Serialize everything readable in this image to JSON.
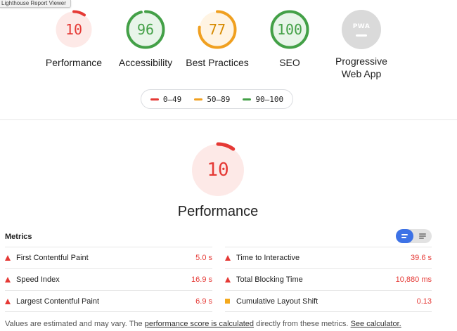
{
  "tooltip": "Lighthouse Report Viewer",
  "gauges": [
    {
      "score": "10",
      "label": "Performance",
      "fraction": 0.1,
      "color": "#e53935",
      "bg": "#fde9e7"
    },
    {
      "score": "96",
      "label": "Accessibility",
      "fraction": 0.96,
      "color": "#43a047",
      "bg": "#e8f5e9"
    },
    {
      "score": "77",
      "label": "Best Practices",
      "fraction": 0.77,
      "color": "#f0a020",
      "bg": "#fff4e3"
    },
    {
      "score": "100",
      "label": "SEO",
      "fraction": 1.0,
      "color": "#43a047",
      "bg": "#e8f5e9"
    },
    {
      "badge": "PWA",
      "label_line1": "Progressive",
      "label_line2": "Web App",
      "color": "#9e9e9e",
      "bg": "#dadada"
    }
  ],
  "legend": [
    {
      "range": "0–49",
      "color": "#e53935"
    },
    {
      "range": "50–89",
      "color": "#f0a020"
    },
    {
      "range": "90–100",
      "color": "#43a047"
    }
  ],
  "performance": {
    "score": "10",
    "title": "Performance",
    "fraction": 0.1,
    "color": "#e53935",
    "bg": "#fde9e7"
  },
  "metrics": {
    "title": "Metrics",
    "left": [
      {
        "name": "First Contentful Paint",
        "value": "5.0 s",
        "icon": "fail-triangle-icon"
      },
      {
        "name": "Speed Index",
        "value": "16.9 s",
        "icon": "fail-triangle-icon"
      },
      {
        "name": "Largest Contentful Paint",
        "value": "6.9 s",
        "icon": "fail-triangle-icon"
      }
    ],
    "right": [
      {
        "name": "Time to Interactive",
        "value": "39.6 s",
        "icon": "fail-triangle-icon"
      },
      {
        "name": "Total Blocking Time",
        "value": "10,880 ms",
        "icon": "fail-triangle-icon"
      },
      {
        "name": "Cumulative Layout Shift",
        "value": "0.13",
        "icon": "average-square-icon"
      }
    ]
  },
  "footer": {
    "text1": "Values are estimated and may vary. The ",
    "link1": "performance score is calculated",
    "text2": " directly from these metrics. ",
    "link2": "See calculator."
  }
}
